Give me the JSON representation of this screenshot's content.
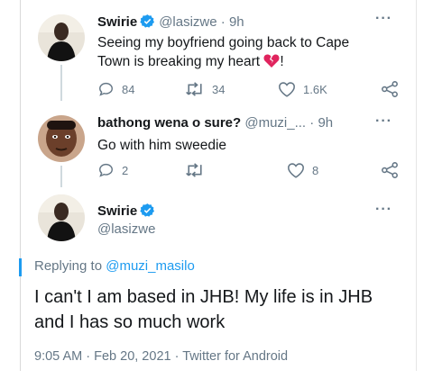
{
  "tweets": [
    {
      "name": "Swirie",
      "verified": true,
      "handle": "@lasizwe",
      "dot": "·",
      "time": "9h",
      "more": "···",
      "text_line1": "Seeing my boyfriend going back to Cape",
      "text_line2": "Town is breaking my heart",
      "emoji": "broken-heart-icon",
      "text_end": "!",
      "replies": "84",
      "retweets": "34",
      "likes": "1.6K"
    },
    {
      "name": "bathong wena o sure?",
      "handle": "@muzi_...",
      "dot": "·",
      "time": "9h",
      "more": "···",
      "text": "Go with him sweedie",
      "replies": "2",
      "retweets": "",
      "likes": "8"
    }
  ],
  "main_tweet": {
    "name": "Swirie",
    "verified": true,
    "handle": "@lasizwe",
    "more": "···",
    "replying_prefix": "Replying to ",
    "replying_handle": "@muzi_masilo",
    "text": "I can't I am based in JHB! My life is in JHB and I has so much work",
    "timestamp": "9:05 AM",
    "dot": "·",
    "date": "Feb 20, 2021",
    "dot2": "·",
    "source": "Twitter for Android"
  },
  "colors": {
    "accent": "#1d9bf0",
    "secondary_text": "#657786",
    "broken_heart": "#e0245e"
  }
}
